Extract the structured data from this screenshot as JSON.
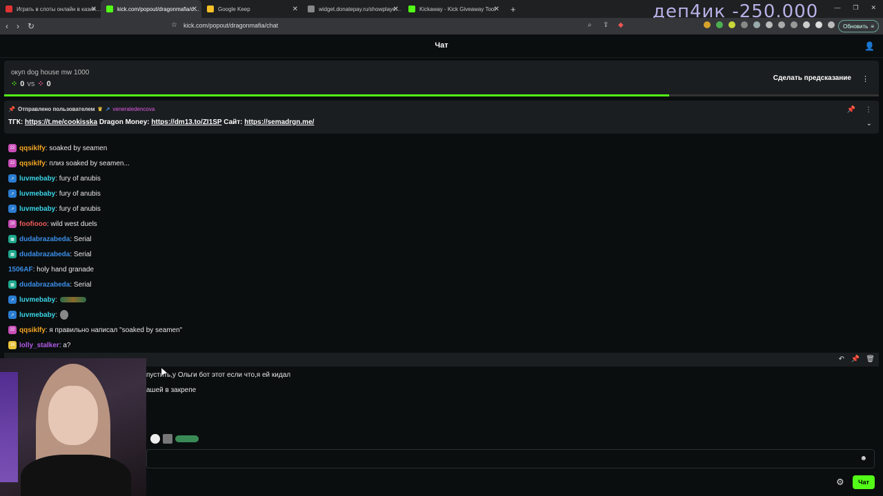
{
  "browser": {
    "tabs": [
      {
        "label": "Играть в слоты онлайн в казин…",
        "color": "#d33"
      },
      {
        "label": "kick.com/popout/dragonmafia/c…",
        "color": "#53fc18",
        "active": true
      },
      {
        "label": "Google Keep",
        "color": "#f6c026"
      },
      {
        "label": "widget.donatepay.ru/showplaye…",
        "color": "#888"
      },
      {
        "label": "Kickaway - Kick Giveaway Tool",
        "color": "#53fc18"
      }
    ],
    "new_tab": "+",
    "url": "kick.com/popout/dragonmafia/chat",
    "update_label": "Обновить"
  },
  "overlay_text": "деп4ик -250.000",
  "header": {
    "title": "Чат"
  },
  "prediction": {
    "question": "окуп dog house mw 1000",
    "left_score": "0",
    "vs": "vs",
    "right_score": "0",
    "button": "Сделать предсказание",
    "progress": 0.76
  },
  "pinned": {
    "sent_by": "Отправлено пользователем",
    "user": "veneraledencova",
    "prefix": "ТГК:",
    "link1": "https://t.me/cookisska",
    "mid1": "Dragon Money:",
    "link2": "https://dm13.to/ZI1SP",
    "mid2": "Сайт:",
    "link3": "https://semadrgn.me/"
  },
  "messages": [
    {
      "user": "qqsiklfy",
      "text": ": soaked by seamen",
      "color": "#f5a623",
      "badge": "#c94fb8",
      "badge_text": "22"
    },
    {
      "user": "qqsiklfy",
      "text": ": плиз soaked by seamen...",
      "color": "#f5a623",
      "badge": "#c94fb8",
      "badge_text": "22"
    },
    {
      "user": "luvmebaby",
      "text": ": fury of anubis",
      "color": "#3ad5e8",
      "badge": "#2a7dd1",
      "badge_text": "↗"
    },
    {
      "user": "luvmebaby",
      "text": ": fury of anubis",
      "color": "#3ad5e8",
      "badge": "#2a7dd1",
      "badge_text": "↗"
    },
    {
      "user": "luvmebaby",
      "text": ": fury of anubis",
      "color": "#3ad5e8",
      "badge": "#2a7dd1",
      "badge_text": "↗"
    },
    {
      "user": "foofiooo",
      "text": ": wild west duels",
      "color": "#f05a5a",
      "badge": "#c94fb8",
      "badge_text": "28"
    },
    {
      "user": "dudabrazabeda",
      "text": ": Serial",
      "color": "#3a8ee8",
      "badge": "#1fa88c",
      "badge_text": "▦"
    },
    {
      "user": "dudabrazabeda",
      "text": ": Serial",
      "color": "#3a8ee8",
      "badge": "#1fa88c",
      "badge_text": "▦"
    },
    {
      "user": "1506AF",
      "text": ": holy hand granade",
      "color": "#3a8ee8",
      "badge": "",
      "badge_text": ""
    },
    {
      "user": "dudabrazabeda",
      "text": ": Serial",
      "color": "#3a8ee8",
      "badge": "#1fa88c",
      "badge_text": "▦"
    },
    {
      "user": "luvmebaby",
      "text": ":",
      "color": "#3ad5e8",
      "badge": "#2a7dd1",
      "badge_text": "↗",
      "emote": "wide"
    },
    {
      "user": "luvmebaby",
      "text": ":",
      "color": "#3ad5e8",
      "badge": "#2a7dd1",
      "badge_text": "↗",
      "emote": "round"
    },
    {
      "user": "qqsiklfy",
      "text": ": я правильно написал \"soaked by seamen\"",
      "color": "#f5a623",
      "badge": "#c94fb8",
      "badge_text": "22"
    },
    {
      "user": "lolly_stalker",
      "text": ": а?",
      "color": "#b15be8",
      "badge": "#e8c23a",
      "badge_text": "16"
    }
  ],
  "partial_msgs": [
    "пустить,у Ольги бот этот если что,я ей кидал",
    "ашей в закрепе"
  ],
  "send_label": "Чат"
}
